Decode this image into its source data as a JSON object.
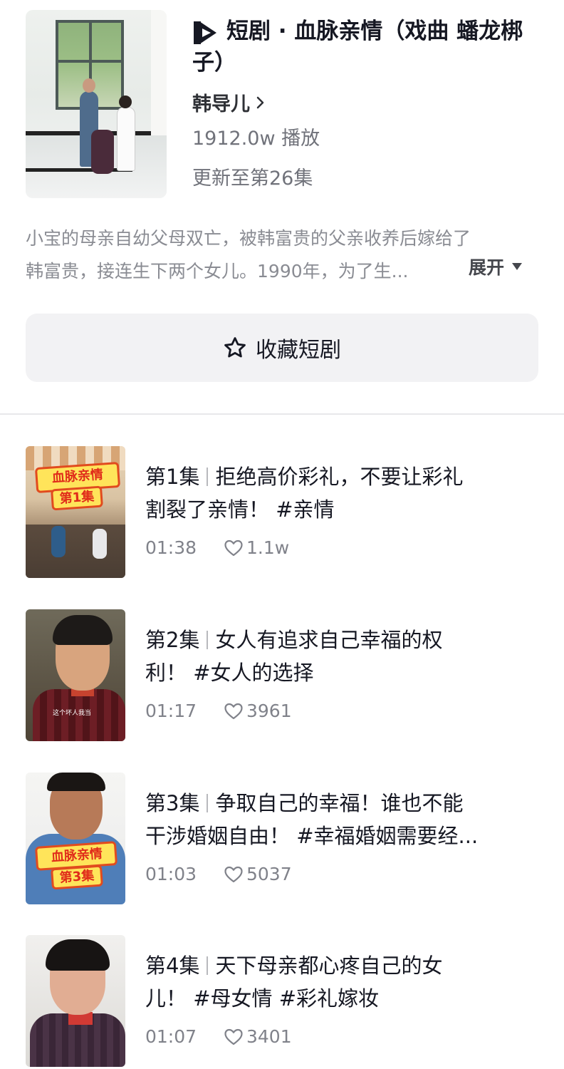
{
  "drama": {
    "title": "短剧 · 血脉亲情（戏曲 蟠龙梆子）",
    "author": "韩导儿",
    "plays": "1912.0w 播放",
    "update_status": "更新至第26集",
    "description_line1": "小宝的母亲自幼父母双亡，被韩富贵的父亲收养后嫁给了",
    "description_line2": "韩富贵，接连生下两个女儿。1990年，为了生...",
    "expand_label": "展开",
    "favorite_label": "收藏短剧"
  },
  "episodes": [
    {
      "number": "第1集",
      "title_line1": "拒绝高价彩礼，不要让彩礼",
      "title_line2": "割裂了亲情！ #亲情",
      "duration": "01:38",
      "likes": "1.1w",
      "thumb_badge_top": "血脉亲情",
      "thumb_badge_bottom": "第1集"
    },
    {
      "number": "第2集",
      "title_line1": "女人有追求自己幸福的权",
      "title_line2": "利！ #女人的选择",
      "duration": "01:17",
      "likes": "3961",
      "thumb_caption": "这个坏人我当"
    },
    {
      "number": "第3集",
      "title_line1": "争取自己的幸福！谁也不能",
      "title_line2": "干涉婚姻自由！ #幸福婚姻需要经...",
      "duration": "01:03",
      "likes": "5037",
      "thumb_badge_top": "血脉亲情",
      "thumb_badge_bottom": "第3集"
    },
    {
      "number": "第4集",
      "title_line1": "天下母亲都心疼自己的女",
      "title_line2": "儿！ #母女情 #彩礼嫁妆",
      "duration": "01:07",
      "likes": "3401"
    }
  ],
  "icons": {
    "brand": "short-drama-logo-icon",
    "chevron": "chevron-right-icon",
    "expand": "triangle-down-icon",
    "favorite": "star-outline-icon",
    "likes": "heart-outline-icon"
  },
  "colors": {
    "text_primary": "#161823",
    "text_secondary": "#70727a",
    "button_bg": "#f2f2f4",
    "badge_yellow": "#ffe45a",
    "badge_red": "#e14b1e"
  }
}
